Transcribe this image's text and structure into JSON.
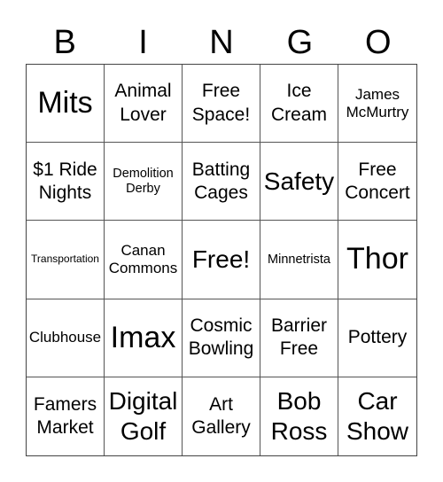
{
  "header": {
    "letters": [
      "B",
      "I",
      "N",
      "G",
      "O"
    ]
  },
  "cells": [
    {
      "text": "Mits",
      "size": "xxl"
    },
    {
      "text": "Animal Lover",
      "size": "lg"
    },
    {
      "text": "Free Space!",
      "size": "lg"
    },
    {
      "text": "Ice Cream",
      "size": "lg"
    },
    {
      "text": "James McMurtry",
      "size": "md"
    },
    {
      "text": "$1 Ride Nights",
      "size": "lg"
    },
    {
      "text": "Demolition Derby",
      "size": "sm"
    },
    {
      "text": "Batting Cages",
      "size": "lg"
    },
    {
      "text": "Safety",
      "size": "xl"
    },
    {
      "text": "Free Concert",
      "size": "lg"
    },
    {
      "text": "Transportation",
      "size": "xs"
    },
    {
      "text": "Canan Commons",
      "size": "md"
    },
    {
      "text": "Free!",
      "size": "xl"
    },
    {
      "text": "Minnetrista",
      "size": "sm"
    },
    {
      "text": "Thor",
      "size": "xxl"
    },
    {
      "text": "Clubhouse",
      "size": "md"
    },
    {
      "text": "Imax",
      "size": "xxl"
    },
    {
      "text": "Cosmic Bowling",
      "size": "lg"
    },
    {
      "text": "Barrier Free",
      "size": "lg"
    },
    {
      "text": "Pottery",
      "size": "lg"
    },
    {
      "text": "Famers Market",
      "size": "lg"
    },
    {
      "text": "Digital Golf",
      "size": "xl"
    },
    {
      "text": "Art Gallery",
      "size": "lg"
    },
    {
      "text": "Bob Ross",
      "size": "xl"
    },
    {
      "text": "Car Show",
      "size": "xl"
    }
  ]
}
